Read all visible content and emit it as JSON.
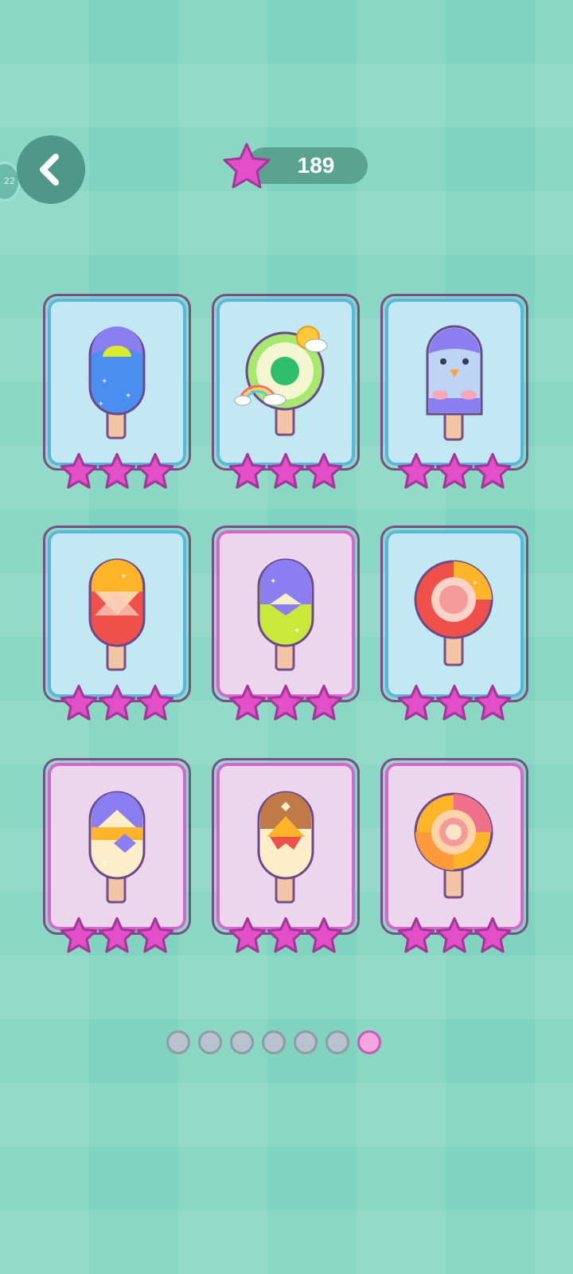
{
  "header": {
    "side_badge_text": "22",
    "back_icon": "chevron-left-icon",
    "score": "189",
    "score_icon": "star-icon"
  },
  "colors": {
    "accent_star": "#e24fc9",
    "card_blue_bg": "#c2e9f3",
    "card_pink_bg": "#ecd6ee"
  },
  "cards": [
    {
      "item": "blue-popsicle-icon",
      "theme": "blue",
      "stars": 3
    },
    {
      "item": "green-lollipop-icon",
      "theme": "blue",
      "stars": 3
    },
    {
      "item": "penguin-popsicle-icon",
      "theme": "blue",
      "stars": 3
    },
    {
      "item": "orange-red-popsicle-icon",
      "theme": "blue",
      "stars": 3
    },
    {
      "item": "purple-green-popsicle-icon",
      "theme": "pink",
      "stars": 3
    },
    {
      "item": "red-lollipop-icon",
      "theme": "blue",
      "stars": 3
    },
    {
      "item": "purple-yellow-popsicle-icon",
      "theme": "pink",
      "stars": 3
    },
    {
      "item": "chocolate-popsicle-icon",
      "theme": "pink",
      "stars": 3
    },
    {
      "item": "orange-lollipop-icon",
      "theme": "pink",
      "stars": 3
    }
  ],
  "pagination": {
    "total": 7,
    "active_index": 6
  }
}
